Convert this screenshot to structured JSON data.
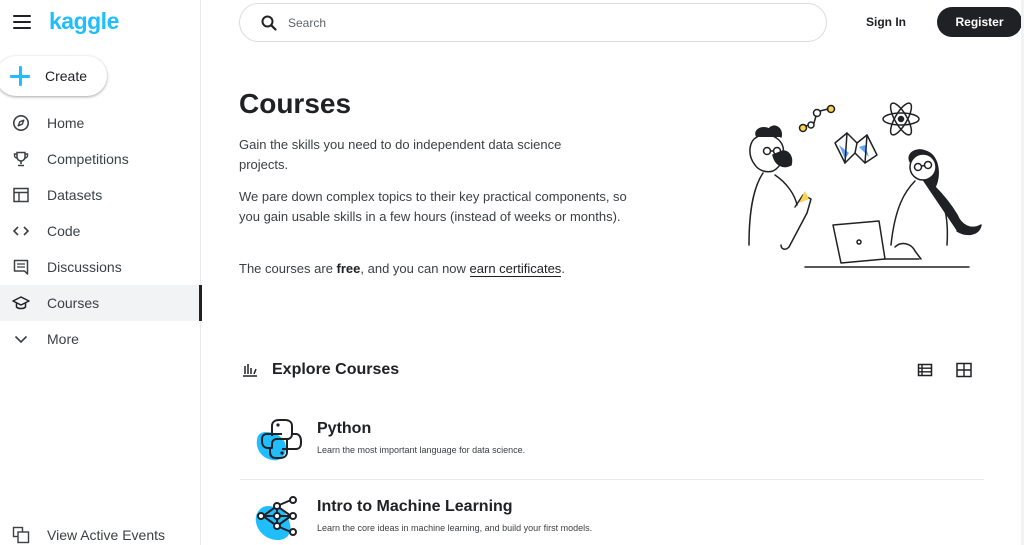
{
  "sidebar": {
    "logo": "kaggle",
    "create_label": "Create",
    "items": [
      {
        "label": "Home",
        "icon": "compass-icon"
      },
      {
        "label": "Competitions",
        "icon": "trophy-icon"
      },
      {
        "label": "Datasets",
        "icon": "table-icon"
      },
      {
        "label": "Code",
        "icon": "code-icon"
      },
      {
        "label": "Discussions",
        "icon": "discussion-icon"
      },
      {
        "label": "Courses",
        "icon": "graduation-cap-icon",
        "active": true
      },
      {
        "label": "More",
        "icon": "chevron-down-icon"
      }
    ],
    "footer_label": "View Active Events"
  },
  "header": {
    "search_placeholder": "Search",
    "signin_label": "Sign In",
    "register_label": "Register"
  },
  "main": {
    "title": "Courses",
    "p1": "Gain the skills you need to do independent data science projects.",
    "p2": "We pare down complex topics to their key practical components, so you gain usable skills in a few hours (instead of weeks or months).",
    "p3_prefix": "The courses are ",
    "p3_bold": "free",
    "p3_middle": ", and you can now ",
    "p3_link": "earn certificates",
    "p3_suffix": ".",
    "explore_title": "Explore Courses",
    "courses": [
      {
        "title": "Python",
        "description": "Learn the most important language for data science."
      },
      {
        "title": "Intro to Machine Learning",
        "description": "Learn the core ideas in machine learning, and build your first models."
      }
    ]
  },
  "colors": {
    "brand": "#20beff",
    "dark": "#202124"
  }
}
